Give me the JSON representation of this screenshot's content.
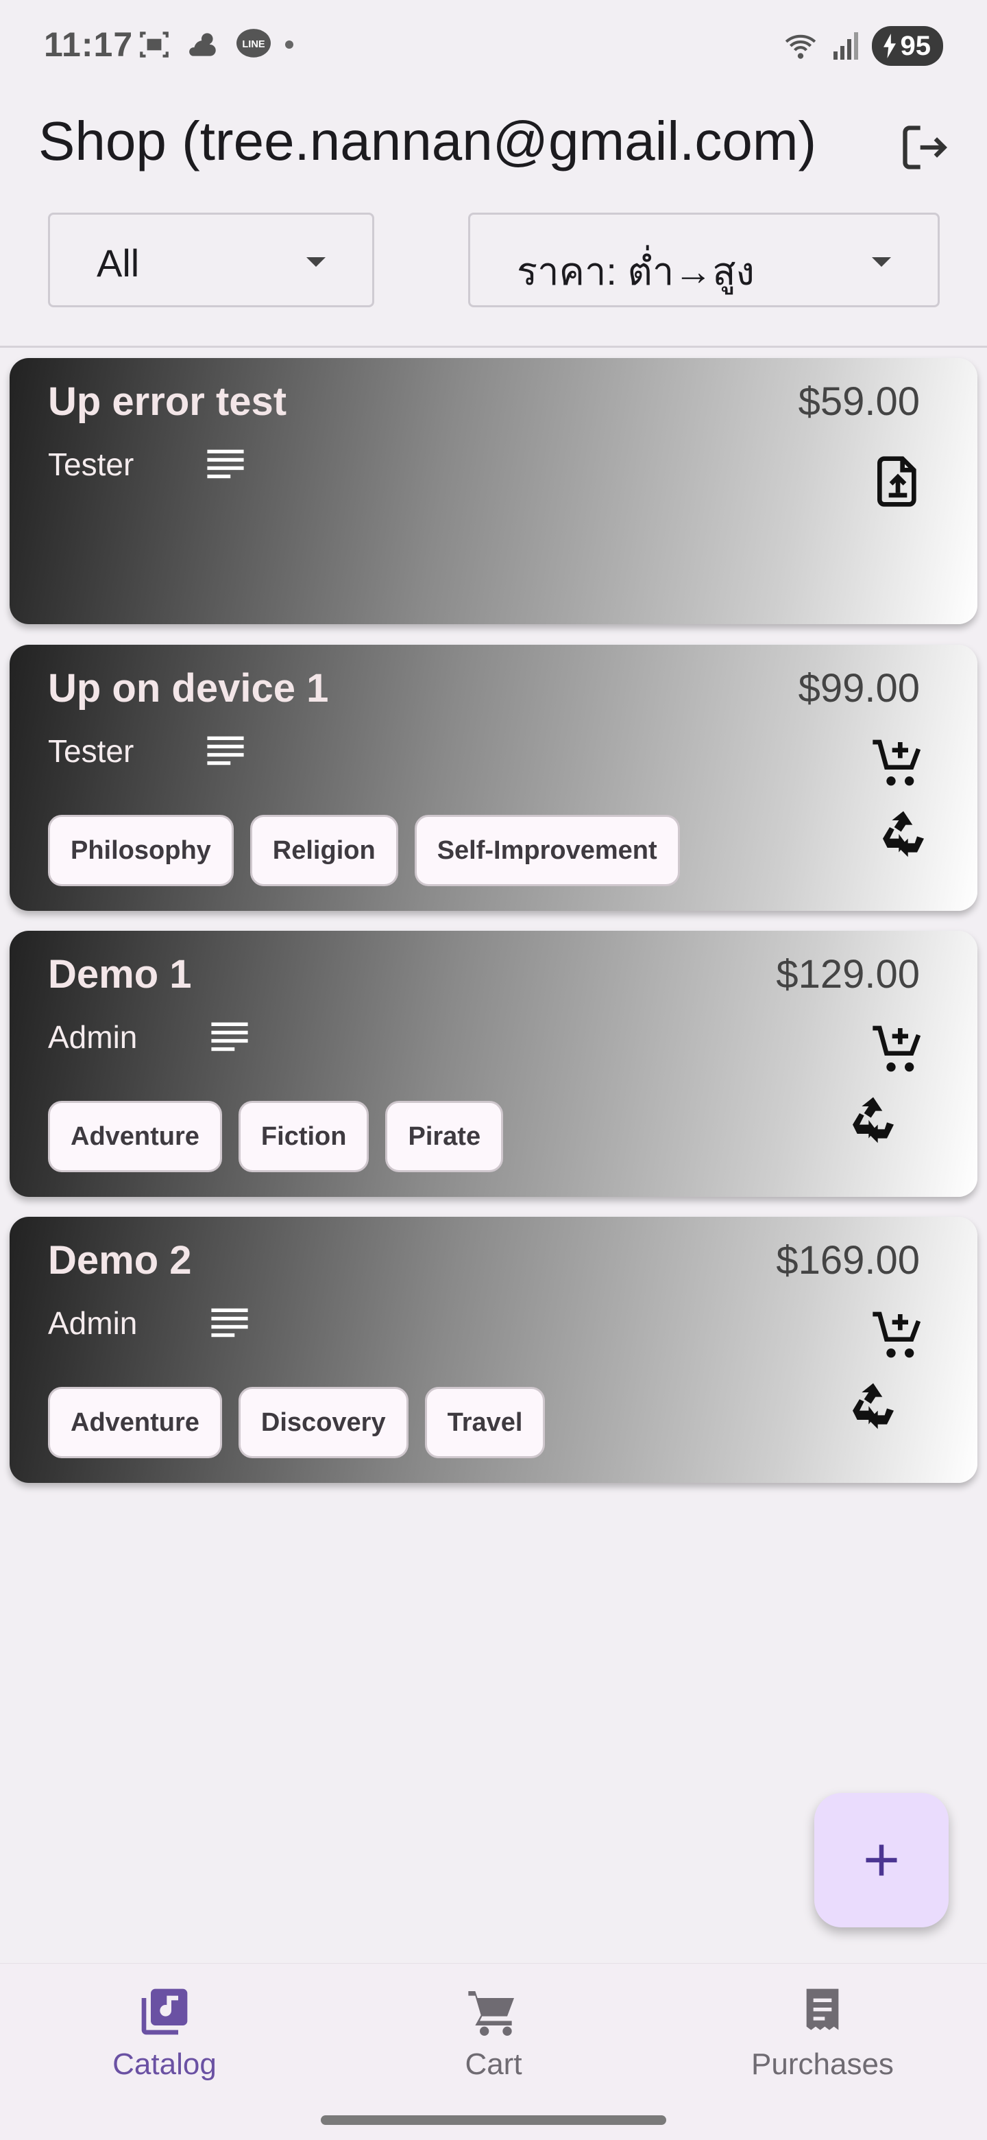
{
  "status_bar": {
    "time": "11:17",
    "battery": "95",
    "icons_left": [
      "screenshot-icon",
      "weather-cloud-icon",
      "line-app-icon"
    ],
    "icons_right": [
      "wifi-icon",
      "signal-icon",
      "battery-charging-icon"
    ]
  },
  "app_bar": {
    "title": "Shop (tree.nannan@gmail.com)",
    "logout_icon": "logout-icon"
  },
  "filters": {
    "category": "All",
    "sort": "ราคา: ต่ำ→สูง"
  },
  "products": [
    {
      "title": "Up error test",
      "author": "Tester",
      "price": "$59.00",
      "tags": [],
      "actions": [
        "upload-file-icon"
      ]
    },
    {
      "title": "Up on device 1",
      "author": "Tester",
      "price": "$99.00",
      "tags": [
        "Philosophy",
        "Religion",
        "Self-Improvement"
      ],
      "actions": [
        "add-to-cart-icon",
        "recycle-icon"
      ]
    },
    {
      "title": "Demo 1",
      "author": "Admin",
      "price": "$129.00",
      "tags": [
        "Adventure",
        "Fiction",
        "Pirate"
      ],
      "actions": [
        "add-to-cart-icon",
        "recycle-icon"
      ]
    },
    {
      "title": "Demo 2",
      "author": "Admin",
      "price": "$169.00",
      "tags": [
        "Adventure",
        "Discovery",
        "Travel"
      ],
      "actions": [
        "add-to-cart-icon",
        "recycle-icon"
      ]
    }
  ],
  "fab": {
    "icon": "plus-icon"
  },
  "bottom_nav": [
    {
      "label": "Catalog",
      "icon": "library-music-icon",
      "selected": true
    },
    {
      "label": "Cart",
      "icon": "cart-icon",
      "selected": false
    },
    {
      "label": "Purchases",
      "icon": "receipt-icon",
      "selected": false
    }
  ],
  "colors": {
    "background": "#f2eff3",
    "accent": "#6a51a3",
    "fab": "#eadcfd",
    "tag_bg": "#fdf7fc"
  }
}
